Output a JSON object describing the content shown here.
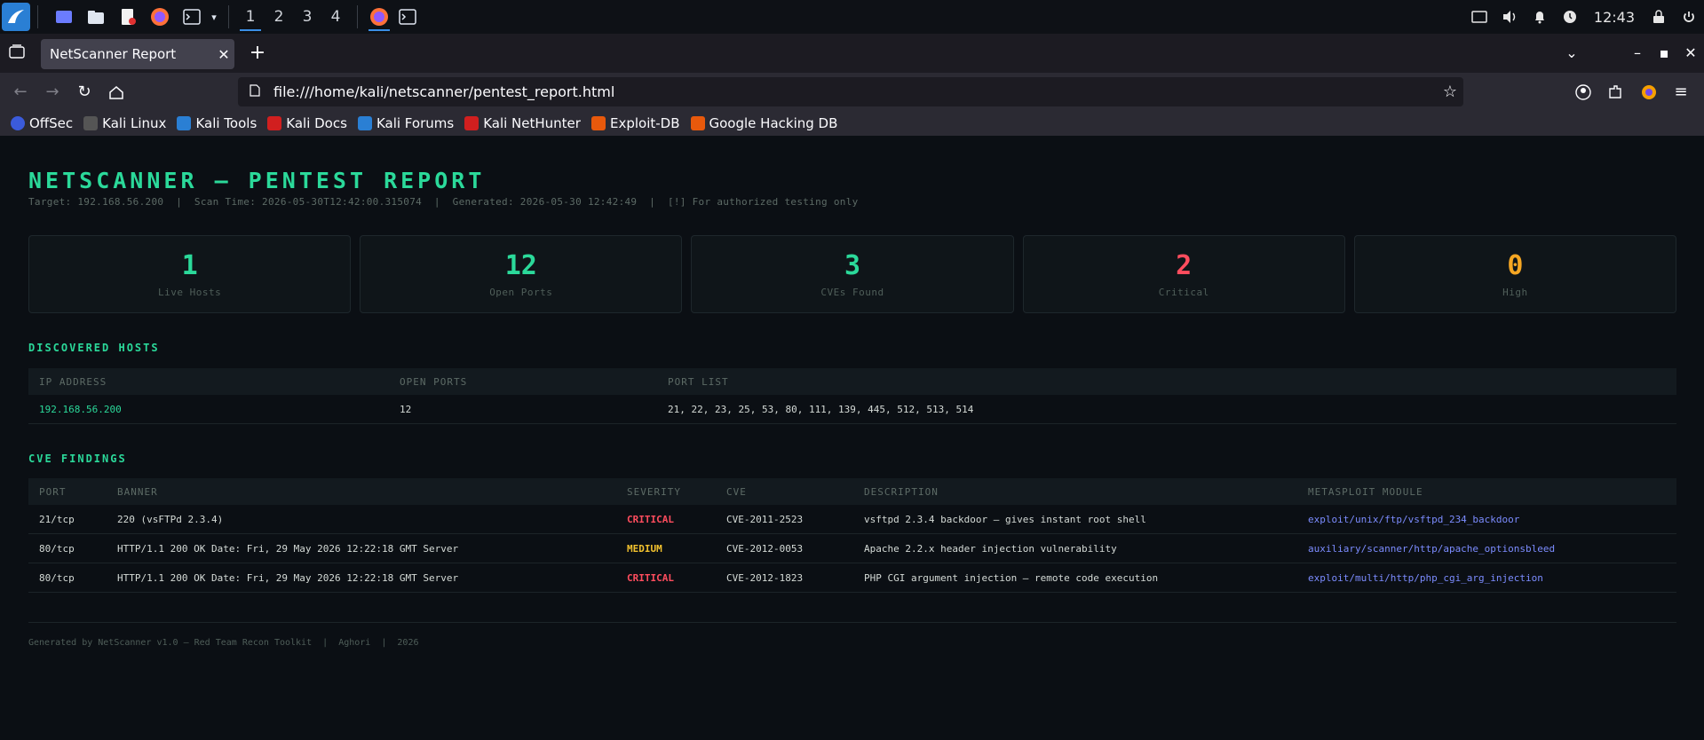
{
  "taskbar": {
    "workspaces": [
      "1",
      "2",
      "3",
      "4"
    ],
    "active_workspace": "1",
    "clock": "12:43"
  },
  "browser": {
    "tab_title": "NetScanner Report",
    "url": "file:///home/kali/netscanner/pentest_report.html",
    "bookmarks": [
      {
        "label": "OffSec",
        "color": "#3b5bdb"
      },
      {
        "label": "Kali Linux",
        "color": "#1e1e1e"
      },
      {
        "label": "Kali Tools",
        "color": "#2a7fd4"
      },
      {
        "label": "Kali Docs",
        "color": "#d11f1f"
      },
      {
        "label": "Kali Forums",
        "color": "#2a7fd4"
      },
      {
        "label": "Kali NetHunter",
        "color": "#d11f1f"
      },
      {
        "label": "Exploit-DB",
        "color": "#e8590c"
      },
      {
        "label": "Google Hacking DB",
        "color": "#e8590c"
      }
    ]
  },
  "report": {
    "title": "NETSCANNER — PENTEST REPORT",
    "meta": "Target: 192.168.56.200  |  Scan Time: 2026-05-30T12:42:00.315074  |  Generated: 2026-05-30 12:42:49  |  [!] For authorized testing only",
    "stats": [
      {
        "value": "1",
        "label": "Live Hosts",
        "color": "#2bd99a"
      },
      {
        "value": "12",
        "label": "Open Ports",
        "color": "#2bd99a"
      },
      {
        "value": "3",
        "label": "CVEs Found",
        "color": "#2bd99a"
      },
      {
        "value": "2",
        "label": "Critical",
        "color": "#ff4d5e"
      },
      {
        "value": "0",
        "label": "High",
        "color": "#f5a623"
      }
    ],
    "hosts_section": "DISCOVERED HOSTS",
    "hosts_headers": [
      "IP ADDRESS",
      "OPEN PORTS",
      "PORT LIST"
    ],
    "hosts": [
      {
        "ip": "192.168.56.200",
        "open_ports": "12",
        "port_list": "21, 22, 23, 25, 53, 80, 111, 139, 445, 512, 513, 514"
      }
    ],
    "cve_section": "CVE FINDINGS",
    "cve_headers": [
      "PORT",
      "BANNER",
      "SEVERITY",
      "CVE",
      "DESCRIPTION",
      "METASPLOIT MODULE"
    ],
    "cves": [
      {
        "port": "21/tcp",
        "banner": "220 (vsFTPd 2.3.4)",
        "severity": "CRITICAL",
        "cve": "CVE-2011-2523",
        "description": "vsftpd 2.3.4 backdoor — gives instant root shell",
        "module": "exploit/unix/ftp/vsftpd_234_backdoor"
      },
      {
        "port": "80/tcp",
        "banner": "HTTP/1.1 200 OK Date: Fri, 29 May 2026 12:22:18 GMT Server",
        "severity": "MEDIUM",
        "cve": "CVE-2012-0053",
        "description": "Apache 2.2.x header injection vulnerability",
        "module": "auxiliary/scanner/http/apache_optionsbleed"
      },
      {
        "port": "80/tcp",
        "banner": "HTTP/1.1 200 OK Date: Fri, 29 May 2026 12:22:18 GMT Server",
        "severity": "CRITICAL",
        "cve": "CVE-2012-1823",
        "description": "PHP CGI argument injection — remote code execution",
        "module": "exploit/multi/http/php_cgi_arg_injection"
      }
    ],
    "footer": "Generated by NetScanner v1.0 — Red Team Recon Toolkit  |  Aghori  |  2026"
  }
}
